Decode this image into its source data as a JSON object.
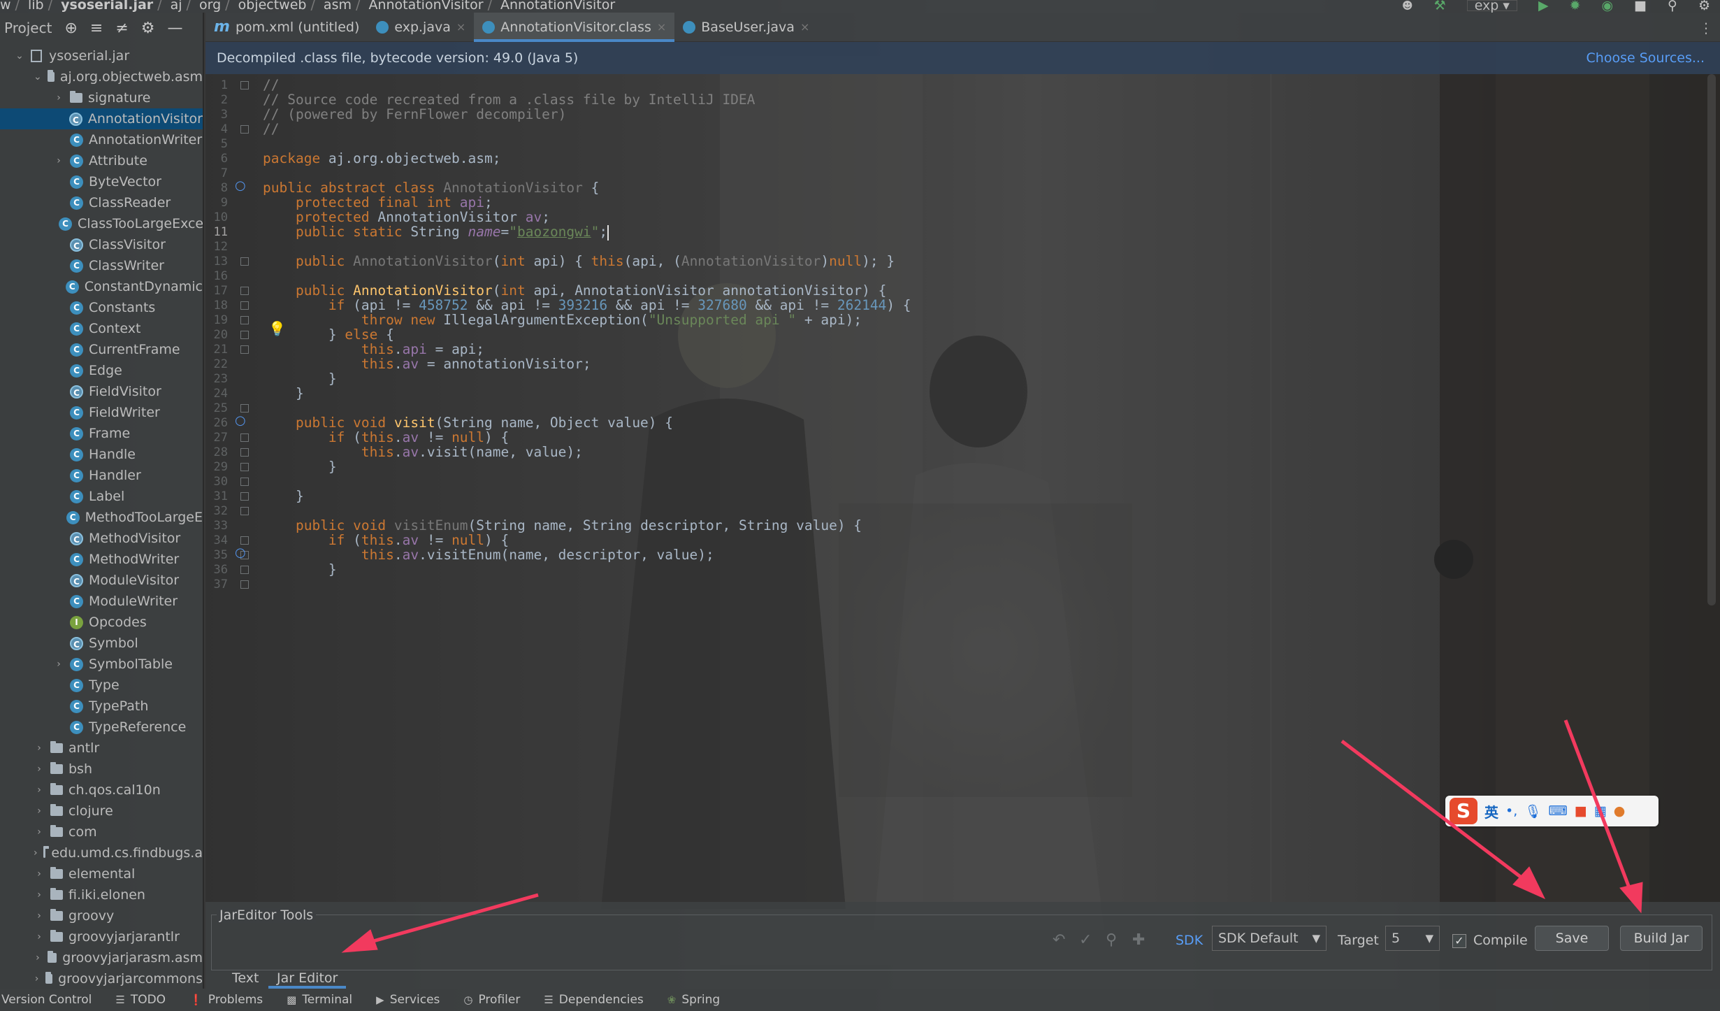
{
  "breadcrumb": [
    "w",
    "lib",
    "ysoserial.jar",
    "aj",
    "org",
    "objectweb",
    "asm",
    "AnnotationVisitor",
    "AnnotationVisitor"
  ],
  "toolbar": {
    "run_config": "exp"
  },
  "sidebar": {
    "title": "Project",
    "root": "ysoserial.jar",
    "package": "aj.org.objectweb.asm",
    "classes": [
      {
        "label": "signature",
        "kind": "folder",
        "arrow": true
      },
      {
        "label": "AnnotationVisitor",
        "kind": "abstract",
        "selected": true
      },
      {
        "label": "AnnotationWriter",
        "kind": "class"
      },
      {
        "label": "Attribute",
        "kind": "class",
        "arrow": true
      },
      {
        "label": "ByteVector",
        "kind": "class"
      },
      {
        "label": "ClassReader",
        "kind": "class"
      },
      {
        "label": "ClassTooLargeExce",
        "kind": "class"
      },
      {
        "label": "ClassVisitor",
        "kind": "abstract"
      },
      {
        "label": "ClassWriter",
        "kind": "class"
      },
      {
        "label": "ConstantDynamic",
        "kind": "class"
      },
      {
        "label": "Constants",
        "kind": "class"
      },
      {
        "label": "Context",
        "kind": "class"
      },
      {
        "label": "CurrentFrame",
        "kind": "class"
      },
      {
        "label": "Edge",
        "kind": "class"
      },
      {
        "label": "FieldVisitor",
        "kind": "abstract"
      },
      {
        "label": "FieldWriter",
        "kind": "class"
      },
      {
        "label": "Frame",
        "kind": "class"
      },
      {
        "label": "Handle",
        "kind": "class"
      },
      {
        "label": "Handler",
        "kind": "class"
      },
      {
        "label": "Label",
        "kind": "class"
      },
      {
        "label": "MethodTooLargeE",
        "kind": "class"
      },
      {
        "label": "MethodVisitor",
        "kind": "abstract"
      },
      {
        "label": "MethodWriter",
        "kind": "class"
      },
      {
        "label": "ModuleVisitor",
        "kind": "abstract"
      },
      {
        "label": "ModuleWriter",
        "kind": "class"
      },
      {
        "label": "Opcodes",
        "kind": "interface"
      },
      {
        "label": "Symbol",
        "kind": "abstract"
      },
      {
        "label": "SymbolTable",
        "kind": "class",
        "arrow": true
      },
      {
        "label": "Type",
        "kind": "class"
      },
      {
        "label": "TypePath",
        "kind": "class"
      },
      {
        "label": "TypeReference",
        "kind": "class"
      }
    ],
    "packages": [
      "antlr",
      "bsh",
      "ch.qos.cal10n",
      "clojure",
      "com",
      "edu.umd.cs.findbugs.a",
      "elemental",
      "fi.iki.elonen",
      "groovy",
      "groovyjarjarantlr",
      "groovyjarjarasm.asm",
      "groovyjarjarcommons"
    ]
  },
  "tabs": [
    {
      "label": "pom.xml (untitled)",
      "icon": "m"
    },
    {
      "label": "exp.java",
      "icon": "c"
    },
    {
      "label": "AnnotationVisitor.class",
      "icon": "c",
      "active": true
    },
    {
      "label": "BaseUser.java",
      "icon": "c"
    }
  ],
  "banner": {
    "text": "Decompiled .class file, bytecode version: 49.0 (Java 5)",
    "choose": "Choose Sources..."
  },
  "code": {
    "line_numbers": [
      "1",
      "2",
      "3",
      "4",
      "5",
      "6",
      "7",
      "8",
      "9",
      "10",
      "11",
      "12",
      "13",
      "16",
      "17",
      "18",
      "19",
      "20",
      "21",
      "22",
      "23",
      "24",
      "25",
      "26",
      "27",
      "28",
      "29",
      "30",
      "31",
      "32",
      "33",
      "34",
      "35",
      "36",
      "37"
    ],
    "current_line": "11"
  },
  "jar_tools": {
    "title": "JarEditor Tools",
    "sdk_label": "SDK",
    "sdk_value": "SDK Default",
    "target_label": "Target",
    "target_value": "5",
    "compile_label": "Compile",
    "save": "Save",
    "build": "Build Jar",
    "tab_text": "Text",
    "tab_editor": "Jar Editor"
  },
  "statusbar": [
    "Version Control",
    "TODO",
    "Problems",
    "Terminal",
    "Services",
    "Profiler",
    "Dependencies",
    "Spring"
  ],
  "ime": {
    "mode": "英",
    "punct": "•,"
  }
}
